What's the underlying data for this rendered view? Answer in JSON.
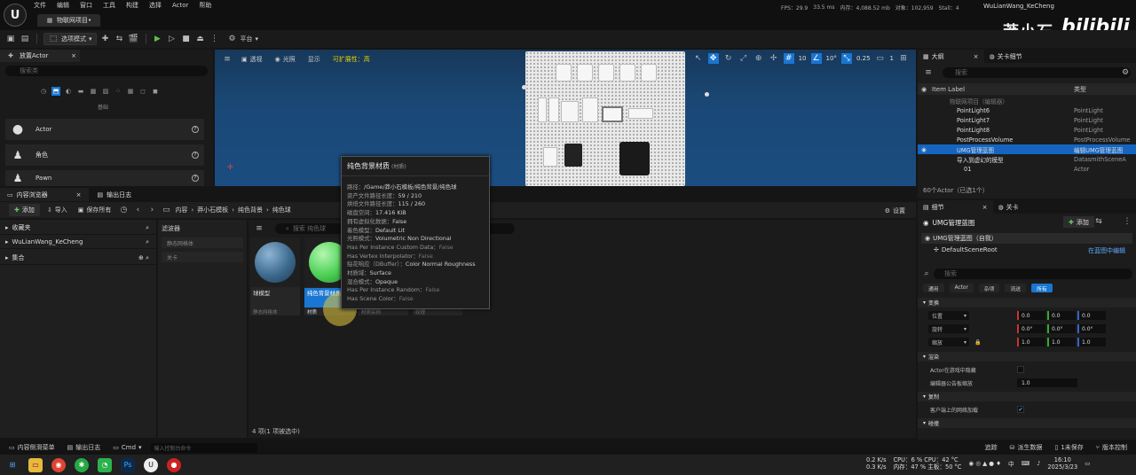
{
  "menu": {
    "items": [
      "文件",
      "编辑",
      "窗口",
      "工具",
      "构建",
      "选择",
      "Actor",
      "帮助"
    ],
    "project_tab": "物联网项目•",
    "stats": [
      "FPS：29.9",
      "33.5 ms",
      "内存：4,088.52 mb",
      "对象：102,959",
      "Stall：4"
    ],
    "user": "WuLianWang_KeCheng"
  },
  "watermark": {
    "text": "莽小石",
    "brand": "bilibili"
  },
  "toolbar": {
    "mode": "选项模式",
    "platform": "平台"
  },
  "place_actors": {
    "tab": "放置Actor",
    "search_placeholder": "搜索类",
    "section": "基础",
    "items": [
      {
        "label": "Actor",
        "icon": "sphere-icon"
      },
      {
        "label": "角色",
        "icon": "pawn-icon"
      },
      {
        "label": "Pawn",
        "icon": "pawn-icon"
      }
    ]
  },
  "viewport": {
    "perspective": "透视",
    "lit": "光照",
    "show": "显示",
    "scalability": "可扩展性：高",
    "grid_size": "10",
    "rotation_snap": "10°",
    "scale_snap": "0.25",
    "camera_speed": "1"
  },
  "tooltip": {
    "title": "纯色背景材质",
    "subtitle": "(材质)",
    "rows": [
      {
        "k": "路径：",
        "v": "/Game/莽小石模板/纯色背景/纯色球"
      },
      {
        "k": "资产文件路径长度：",
        "v": "59 / 210"
      },
      {
        "k": "烘焙文件路径长度：",
        "v": "115 / 260"
      },
      {
        "k": "磁盘空间：",
        "v": "17.416 KiB"
      },
      {
        "k": "拥有虚拟化数据：",
        "v": "False"
      },
      {
        "k": "着色模型：",
        "v": "Default Lit"
      },
      {
        "k": "光照模式：",
        "v": "Volumetric Non Directional"
      },
      {
        "k": "Has Per Instance Custom Data：",
        "v": "False"
      },
      {
        "k": "Has Vertex Interpolator：",
        "v": "False"
      },
      {
        "k": "贴花响应（DBuffer）：",
        "v": "Color Normal Roughness"
      },
      {
        "k": "材质域：",
        "v": "Surface"
      },
      {
        "k": "混合模式：",
        "v": "Opaque"
      },
      {
        "k": "Has Per Instance Random：",
        "v": "False"
      },
      {
        "k": "Has Scene Color：",
        "v": "False"
      }
    ]
  },
  "content_browser": {
    "tab": "内容浏览器",
    "log_tab": "输出日志",
    "add": "添加",
    "import": "导入",
    "save_all": "保存所有",
    "breadcrumb": [
      "内容",
      "莽小石模板",
      "纯色背景",
      "纯色球"
    ],
    "settings": "设置",
    "left_rows": [
      "收藏夹",
      "WuLianWang_KeCheng",
      "集合"
    ],
    "filters_title": "滤波器",
    "filters": [
      "静态网格体",
      "关卡"
    ],
    "search_placeholder": "搜索 纯色球",
    "assets": [
      {
        "label": "球模型",
        "type": "静态网格体",
        "color": "#3d6a8e"
      },
      {
        "label": "纯色背景材质",
        "type": "材质",
        "color": "#4ccf55"
      },
      {
        "label": "",
        "type": "材质实例",
        "color": "#262626"
      },
      {
        "label": "",
        "type": "纹理",
        "color": "#262626"
      }
    ],
    "status": "4 项(1 项被选中)"
  },
  "bottom_bar": {
    "drawer": "内容侧滑菜单",
    "log": "输出日志",
    "cmd": "Cmd",
    "cmd_placeholder": "输入控制台命令",
    "trace": "追踪",
    "derived": "派生数据",
    "unsaved": "1未保存",
    "source_control": "版本控制"
  },
  "outliner": {
    "tab": "大纲",
    "tab2": "关卡细节",
    "search_placeholder": "搜索",
    "col_label": "Item Label",
    "col_type": "类型",
    "rows": [
      {
        "name": "物联网项目（编辑器）",
        "type": "",
        "indent": 0,
        "dim": true
      },
      {
        "name": "PointLight6",
        "type": "PointLight",
        "indent": 1
      },
      {
        "name": "PointLight7",
        "type": "PointLight",
        "indent": 1
      },
      {
        "name": "PointLight8",
        "type": "PointLight",
        "indent": 1
      },
      {
        "name": "PostProcessVolume",
        "type": "PostProcessVolume",
        "indent": 1
      },
      {
        "name": "UMG管理蓝图",
        "type": "编辑UMG管理蓝图",
        "indent": 1,
        "selected": true
      },
      {
        "name": "导入到虚幻的模型",
        "type": "DatasmithSceneA",
        "indent": 1
      },
      {
        "name": "01",
        "type": "Actor",
        "indent": 2
      }
    ],
    "footer": "60个Actor（已选1个）"
  },
  "details": {
    "tab": "细节",
    "tab2": "关卡",
    "title": "UMG管理蓝图",
    "add": "添加",
    "self_label": "UMG管理蓝图（自我）",
    "root": "DefaultSceneRoot",
    "edit_in_bp": "在蓝图中编辑",
    "search_placeholder": "搜索",
    "categories": [
      "通用",
      "Actor",
      "杂项",
      "流送",
      "所有"
    ],
    "transform": {
      "section": "变换",
      "location": {
        "label": "位置",
        "values": [
          "0.0",
          "0.0",
          "0.0"
        ]
      },
      "rotation": {
        "label": "旋转",
        "values": [
          "0.0°",
          "0.0°",
          "0.0°"
        ]
      },
      "scale": {
        "label": "缩放",
        "values": [
          "1.0",
          "1.0",
          "1.0"
        ]
      }
    },
    "render_section": "渲染",
    "hidden_in_game": "Actor在游戏中隐藏",
    "billboard_scale": {
      "label": "编辑器公告板缩放",
      "value": "1.0"
    },
    "replication_section": "复制",
    "net_load": "客户端上的网络加载",
    "collision_section": "碰撞"
  },
  "taskbar": {
    "net": [
      "0.2 K/s",
      "0.3 K/s"
    ],
    "cpu": "CPU：6 %",
    "cpu_temp": "CPU：42 °C",
    "mem": "内存：47 %",
    "mem_temp": "主板：50 °C",
    "lang": "中",
    "time": "16:10",
    "date": "2025/3/23"
  }
}
